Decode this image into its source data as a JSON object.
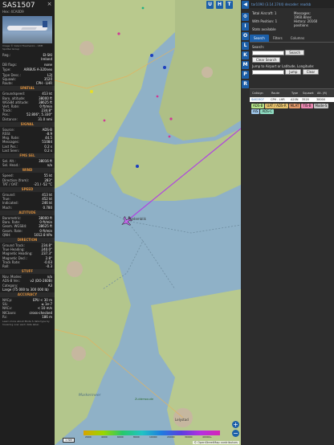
{
  "aircraft": {
    "callsign": "SAS1507",
    "hex_label": "Hex:",
    "hex": "4CA0D9",
    "photo_credit": "Image © Valerii Tkachenko - VRM Spotter Group",
    "reg_label": "Reg.:",
    "reg": "EI-SKI",
    "country": "Ireland",
    "db_flags_label": "DB flags:",
    "db_flags": "none",
    "type_label": "Type:",
    "type": "AIRBUS A-320neo",
    "type_desc_label": "Type Desc.:",
    "type_desc": "L2J",
    "squawk_label": "Squawk:",
    "squawk": "3520",
    "route_label": "Route:",
    "route": "CPH - LHR"
  },
  "sections": {
    "spatial": "SPATIAL",
    "signal": "SIGNAL",
    "fms": "FMS SEL",
    "wind": "WIND",
    "speed": "SPEED",
    "altitude": "ALTITUDE",
    "direction": "DIRECTION",
    "stuff": "STUFF",
    "accuracy": "ACCURACY"
  },
  "spatial": [
    {
      "k": "Groundspeed:",
      "v": "413 kt"
    },
    {
      "k": "Baro. altitude:",
      "v": "38000 ft"
    },
    {
      "k": "WGS84 altitude:",
      "v": "38625 ft"
    },
    {
      "k": "Vert. Rate:",
      "v": "0 ft/min"
    },
    {
      "k": "Track:",
      "v": "234.8°"
    },
    {
      "k": "Pos.:",
      "v": "52.806°, 5.330°"
    },
    {
      "k": "Distance:",
      "v": "31.0 nmi"
    }
  ],
  "signal": [
    {
      "k": "Source:",
      "v": "ADS-B"
    },
    {
      "k": "RSSI:",
      "v": "-8.9"
    },
    {
      "k": "Msg. Rate:",
      "v": "44.5"
    },
    {
      "k": "Messages:",
      "v": "51084"
    },
    {
      "k": "Last Pos.:",
      "v": "0.2 s"
    },
    {
      "k": "Last Seen:",
      "v": "0.2 s"
    }
  ],
  "fms": [
    {
      "k": "Sel. Alt.:",
      "v": "38016 ft"
    },
    {
      "k": "Sel. Head.:",
      "v": "n/a"
    }
  ],
  "wind": [
    {
      "k": "Speed:",
      "v": "55 kt"
    },
    {
      "k": "Direction (from):",
      "v": "283°"
    },
    {
      "k": "TAT / OAT:",
      "v": "-21 / -52 °C"
    }
  ],
  "speed": [
    {
      "k": "Ground:",
      "v": "413 kt"
    },
    {
      "k": "True:",
      "v": "452 kt"
    },
    {
      "k": "Indicated:",
      "v": "246 kt"
    },
    {
      "k": "Mach:",
      "v": "0.780"
    }
  ],
  "altitude": [
    {
      "k": "Barometric:",
      "v": "38000 ft"
    },
    {
      "k": "Baro. Rate:",
      "v": "0 ft/min"
    },
    {
      "k": "Geom. WGS84:",
      "v": "38625 ft"
    },
    {
      "k": "Geom. Rate:",
      "v": "0 ft/min"
    },
    {
      "k": "QNH:",
      "v": "1012.8 hPa"
    }
  ],
  "direction": [
    {
      "k": "Ground Track:",
      "v": "234.8°"
    },
    {
      "k": "True Heading:",
      "v": "240.0°"
    },
    {
      "k": "Magnetic Heading:",
      "v": "237.3°"
    },
    {
      "k": "Magnetic Decl.:",
      "v": "2.8°"
    },
    {
      "k": "Track Rate:",
      "v": "-0.03"
    },
    {
      "k": "Roll:",
      "v": "-0.3"
    }
  ],
  "stuff": [
    {
      "k": "Nav. Modes:",
      "v": "n/a"
    },
    {
      "k": "ADS-B Ver.:",
      "v": "v2 (DO-260B)"
    },
    {
      "k": "Category:",
      "v": "A3"
    }
  ],
  "category_desc": "Large (75 000 to 300 000 lb)",
  "accuracy": [
    {
      "k": "NACp:",
      "v": "EPU < 30 m"
    },
    {
      "k": "SIL:",
      "v": "≤ 1e-7"
    },
    {
      "k": "NACv:",
      "v": "< 10 m/s"
    },
    {
      "k": "NICbaro:",
      "v": "cross-checked"
    },
    {
      "k": "Rc:",
      "v": "186 m"
    }
  ],
  "learn_more": "Learn more about Mode S data type by hovering over each data label.",
  "map": {
    "buttons": [
      "U",
      "H",
      "T"
    ],
    "labels": {
      "town1": "Medemblik",
      "town2": "Lelystad",
      "water": "Markermeer",
      "place": "Zuiderwoude"
    },
    "scale": "1 NM",
    "attribution": "© OpenStreetMap contributors",
    "altitude_scale": [
      "2000",
      "4000",
      "6000",
      "8000",
      "10000",
      "20000",
      "30000",
      "40000+"
    ],
    "accent": "#b044e0"
  },
  "vtool": [
    "I",
    "O",
    "L",
    "K",
    "M",
    "P",
    "R"
  ],
  "panel": {
    "version": "tar1090 (3.14.1744) decoder: readsb",
    "total_aircraft_label": "Total Aircraft:",
    "total_aircraft": "1",
    "with_position_label": "With Position:",
    "with_position": "1",
    "messages_label": "Messages:",
    "messages": "1960.8/sec",
    "history_label": "History:",
    "history": "20160 positions",
    "stats_label": "Stats available",
    "tabs": [
      "Search",
      "Filters",
      "Columns"
    ],
    "search_label": "Search:",
    "search_btn": "Search",
    "clear_search_btn": "Clear Search",
    "jump_label": "Jump to Airport or Latitude, Longitude:",
    "jump_btn": "Jump",
    "clear_btn": "Clear",
    "columns": [
      "Callsign",
      "Route",
      "Type",
      "Squawk",
      "Alt. (ft)"
    ],
    "row": {
      "callsign": "SAS1507",
      "route": "CPH - LHR",
      "type": "A20N",
      "squawk": "3520",
      "alt": "38000"
    },
    "chips": [
      {
        "label": "ADS-B",
        "color": "#b6e48a"
      },
      {
        "label": "UAT / ADS-R",
        "color": "#e7c26d"
      },
      {
        "label": "MLAT",
        "color": "#e39a6b"
      },
      {
        "label": "TIS-B",
        "color": "#e987b0"
      },
      {
        "label": "Mode-S",
        "color": "#c7c7c7"
      },
      {
        "label": "AIS",
        "color": "#9fc7ea"
      },
      {
        "label": "ADS-C",
        "color": "#8fdcc2"
      }
    ]
  }
}
